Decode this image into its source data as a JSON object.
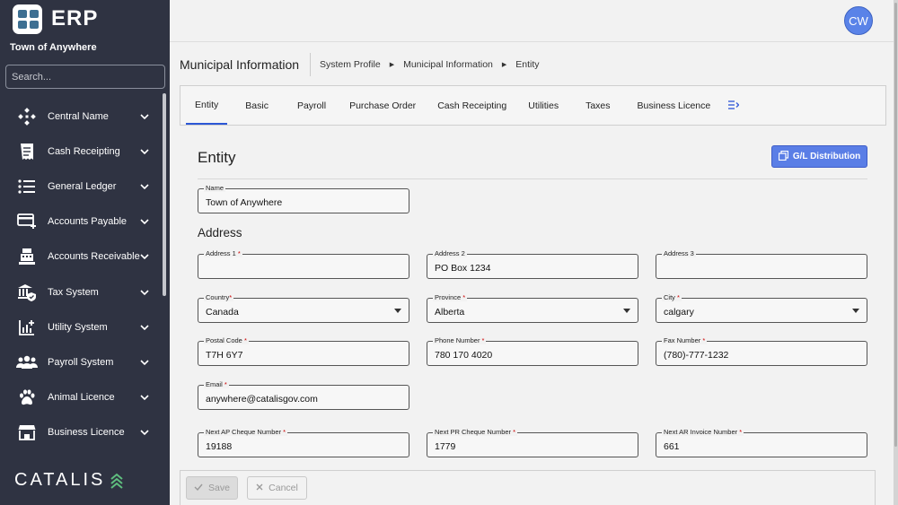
{
  "app": {
    "logo_text": "ERP",
    "org_name": "Town of Anywhere",
    "brand": "CATALIS"
  },
  "search": {
    "placeholder": "Search..."
  },
  "sidebar": {
    "items": [
      {
        "label": "Central Name",
        "icon": "network-icon"
      },
      {
        "label": "Cash Receipting",
        "icon": "receipt-icon"
      },
      {
        "label": "General Ledger",
        "icon": "list-icon"
      },
      {
        "label": "Accounts Payable",
        "icon": "card-plus-icon"
      },
      {
        "label": "Accounts Receivable",
        "icon": "cash-register-icon"
      },
      {
        "label": "Tax System",
        "icon": "government-shield-icon"
      },
      {
        "label": "Utility System",
        "icon": "chart-plus-icon"
      },
      {
        "label": "Payroll System",
        "icon": "people-icon"
      },
      {
        "label": "Animal Licence",
        "icon": "paw-icon"
      },
      {
        "label": "Business Licence",
        "icon": "storefront-icon"
      }
    ]
  },
  "topbar": {
    "avatar_initials": "CW"
  },
  "header": {
    "title": "Municipal Information",
    "breadcrumb": [
      "System Profile",
      "Municipal Information",
      "Entity"
    ]
  },
  "tabs": [
    "Entity",
    "Basic",
    "Payroll",
    "Purchase Order",
    "Cash Receipting",
    "Utilities",
    "Taxes",
    "Business Licence"
  ],
  "entity": {
    "title": "Entity",
    "gl_button": "G/L Distribution",
    "name_label": "Name",
    "name_value": "Town of Anywhere",
    "address_title": "Address"
  },
  "fields": {
    "address1": {
      "label": "Address 1",
      "value": ""
    },
    "address2": {
      "label": "Address 2",
      "value": "PO Box 1234"
    },
    "address3": {
      "label": "Address 3",
      "value": ""
    },
    "country": {
      "label": "Country",
      "value": "Canada"
    },
    "province": {
      "label": "Province",
      "value": "Alberta"
    },
    "city": {
      "label": "City",
      "value": "calgary"
    },
    "postal": {
      "label": "Postal Code",
      "value": "T7H 6Y7"
    },
    "phone": {
      "label": "Phone Number",
      "value": "780 170 4020"
    },
    "fax": {
      "label": "Fax Number",
      "value": "(780)-777-1232"
    },
    "email": {
      "label": "Email",
      "value": "anywhere@catalisgov.com"
    },
    "ap_cheque": {
      "label": "Next AP Cheque Number",
      "value": "19188"
    },
    "pr_cheque": {
      "label": "Next PR Cheque Number",
      "value": "1779"
    },
    "ar_invoice": {
      "label": "Next AR Invoice Number",
      "value": "661"
    }
  },
  "footer": {
    "save_label": "Save",
    "cancel_label": "Cancel"
  },
  "colors": {
    "sidebar_bg": "#2f3342",
    "accent": "#5a7ee6",
    "required": "#cc0000"
  }
}
